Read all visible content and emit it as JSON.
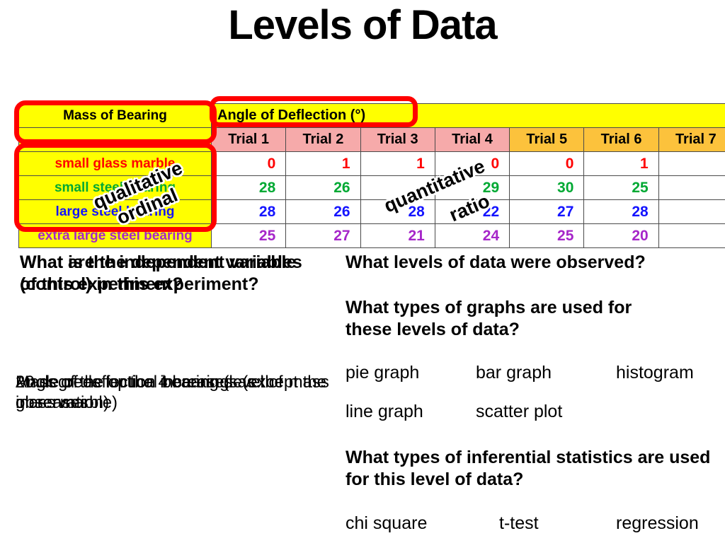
{
  "slide": {
    "title": "Levels of Data"
  },
  "table": {
    "banner_left": "Mass of Bearing",
    "banner_right": "Angle of Deflection (°)",
    "row_label_header": "Mass of Bearing",
    "columns": [
      "Trial 1",
      "Trial 2",
      "Trial 3",
      "Trial 4",
      "Trial 5",
      "Trial 6",
      "Trial 7"
    ],
    "column_header_colors": {
      "pink": "#f6aaaa",
      "gold": "#fcc23c",
      "yellow": "#ffff00"
    },
    "rows": [
      {
        "label": "small glass marble",
        "color": "#ff0000",
        "values": [
          "0",
          "1",
          "1",
          "0",
          "0",
          "1",
          ""
        ]
      },
      {
        "label": "small steel bearing",
        "color": "#00a933",
        "values": [
          "28",
          "26",
          "",
          "29",
          "30",
          "25",
          ""
        ]
      },
      {
        "label": "large steel bearing",
        "color": "#1414ff",
        "values": [
          "28",
          "26",
          "28",
          "22",
          "27",
          "28",
          ""
        ]
      },
      {
        "label": "extra large steel bearing",
        "color": "#a626c9",
        "values": [
          "25",
          "27",
          "21",
          "24",
          "25",
          "20",
          ""
        ]
      }
    ]
  },
  "callouts": {
    "qualitative": "qualitative",
    "ordinal": "ordinal",
    "quantitative": "quantitative",
    "ratio": "ratio"
  },
  "left_column": {
    "question_layer_1": "What is the independent variable of this experiment?",
    "question_layer_2": "What are the dependent variables (control) in this experiment?",
    "answer_layer_1": "Angle of deflection increases as the mass increases",
    "answer_layer_2": "20 degrees for the 4 bearings (except the glass marble)",
    "answer_layer_3": "Mass of the optical bearing (level of observation)"
  },
  "right_column": {
    "question_levels": "What levels of data were observed?",
    "question_graphs": "What types of graphs are used for these levels of data?",
    "graph_types": [
      "pie graph",
      "bar graph",
      "histogram",
      "line graph",
      "scatter plot"
    ],
    "question_stats": "What types of inferential statistics are used for this level of data?",
    "stat_types": [
      "chi square",
      "t-test",
      "regression"
    ]
  },
  "annotation_color": "#ff0000"
}
